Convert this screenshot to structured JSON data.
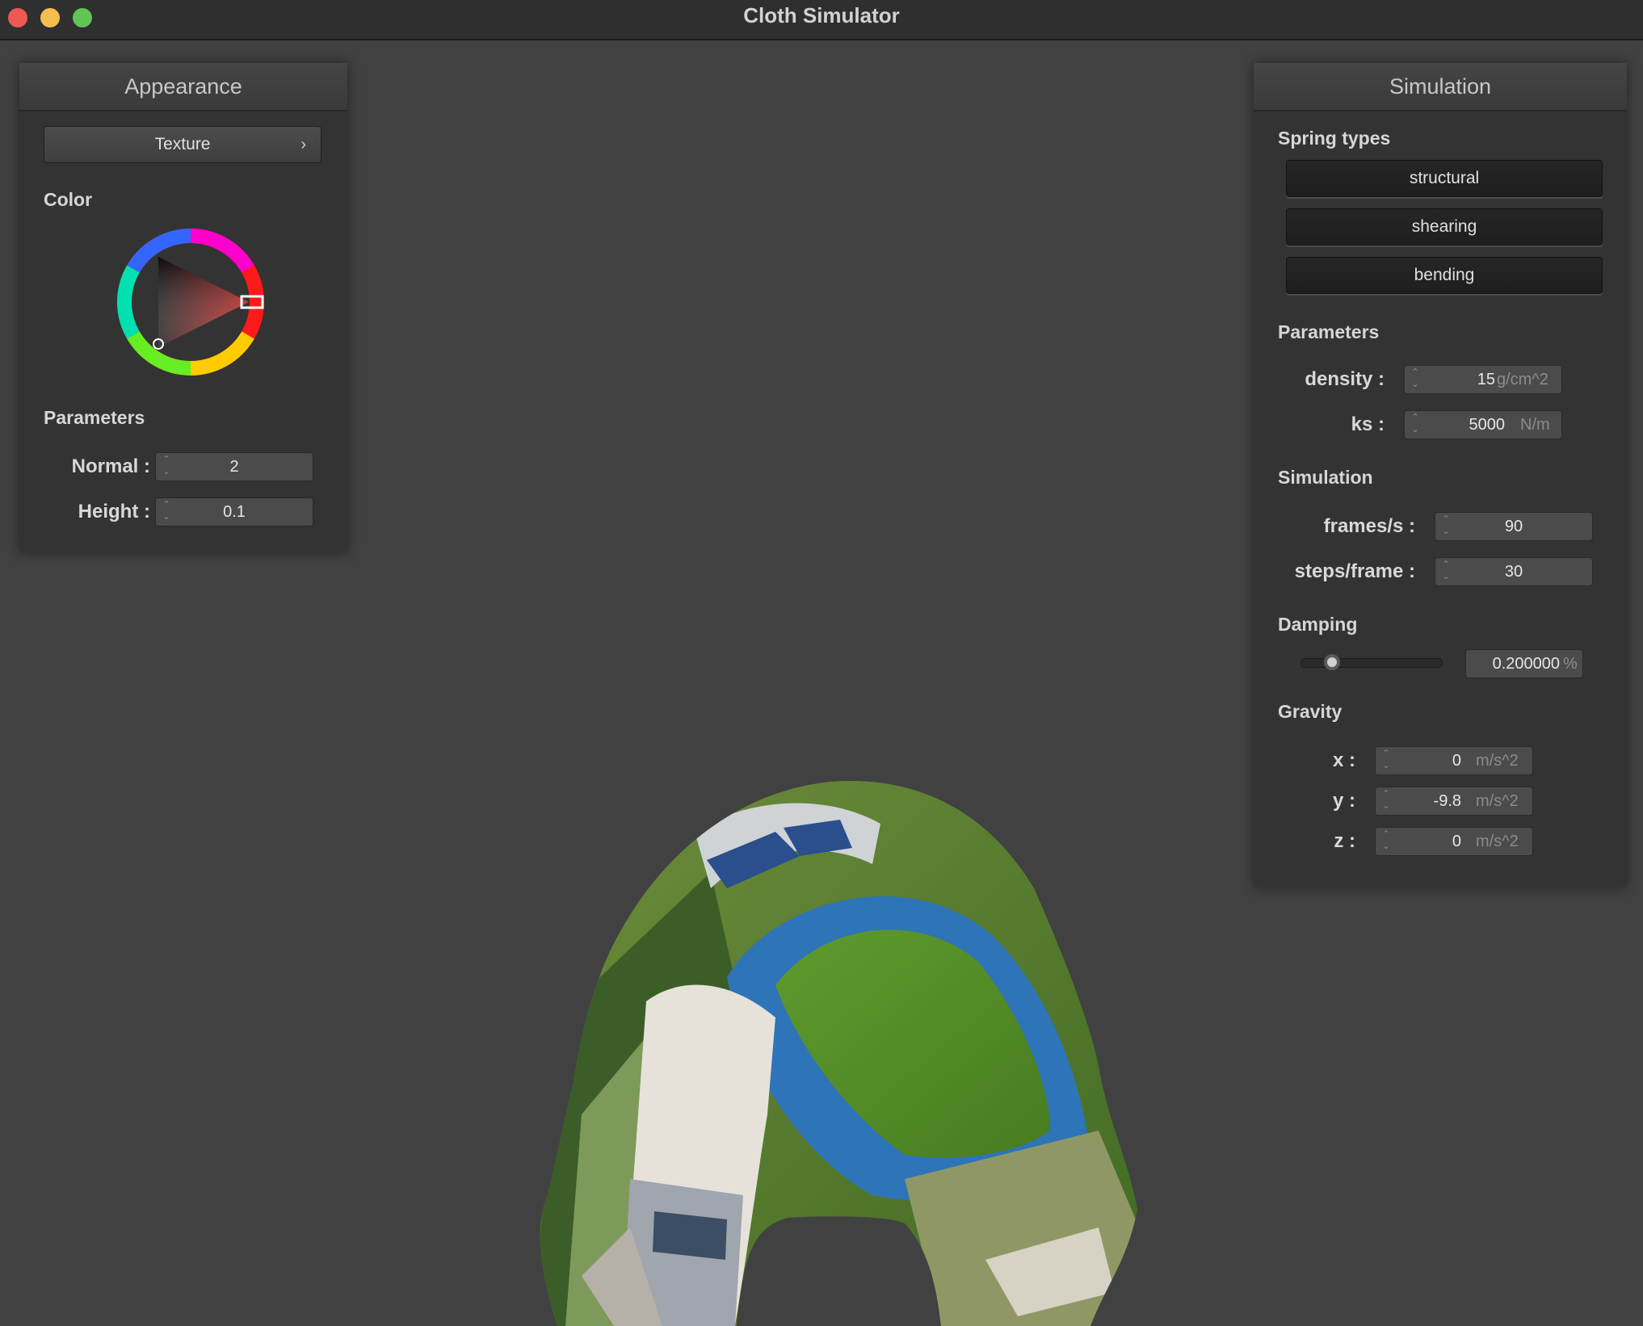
{
  "window": {
    "title": "Cloth Simulator"
  },
  "appearance": {
    "header": "Appearance",
    "texture_button": "Texture",
    "texture_chevron": "›",
    "color_label": "Color",
    "parameters_label": "Parameters",
    "normal": {
      "label": "Normal :",
      "value": "2"
    },
    "height": {
      "label": "Height :",
      "value": "0.1"
    }
  },
  "simulation": {
    "header": "Simulation",
    "spring_types_label": "Spring types",
    "spring_buttons": [
      "structural",
      "shearing",
      "bending"
    ],
    "parameters_label": "Parameters",
    "density": {
      "label": "density :",
      "value": "15",
      "unit": "g/cm^2"
    },
    "ks": {
      "label": "ks :",
      "value": "5000",
      "unit": "N/m"
    },
    "simulation_label": "Simulation",
    "frames_per_s": {
      "label": "frames/s :",
      "value": "90"
    },
    "steps_per_frame": {
      "label": "steps/frame :",
      "value": "30"
    },
    "damping_label": "Damping",
    "damping": {
      "value": "0.200000",
      "unit": "%",
      "slider_fraction": 0.2
    },
    "gravity_label": "Gravity",
    "gravity": {
      "x": {
        "label": "x :",
        "value": "0",
        "unit": "m/s^2"
      },
      "y": {
        "label": "y :",
        "value": "-9.8",
        "unit": "m/s^2"
      },
      "z": {
        "label": "z :",
        "value": "0",
        "unit": "m/s^2"
      }
    }
  },
  "colors": {
    "background": "#414141",
    "panel": "#333333",
    "selected_color": "#e02020"
  }
}
